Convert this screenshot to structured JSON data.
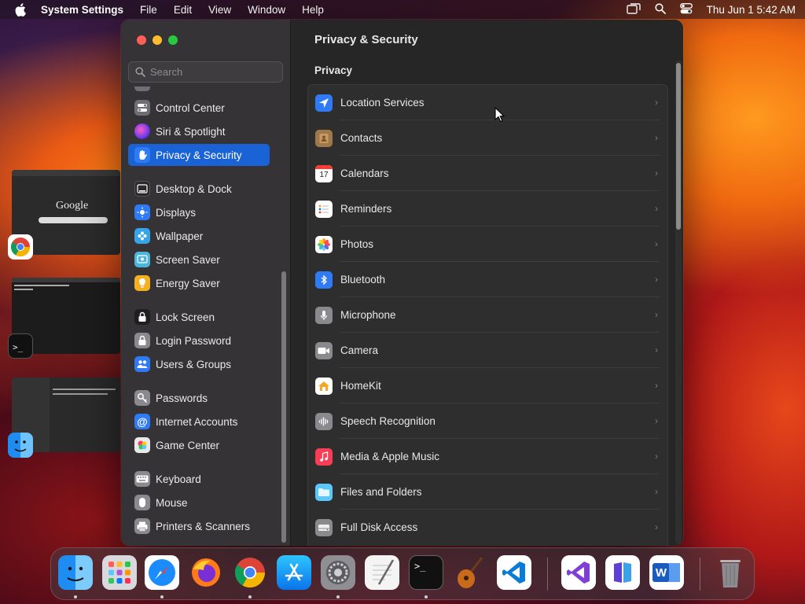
{
  "menubar": {
    "app_name": "System Settings",
    "menus": [
      "File",
      "Edit",
      "View",
      "Window",
      "Help"
    ],
    "clock": "Thu Jun 1  5:42 AM"
  },
  "window": {
    "search_placeholder": "Search",
    "sidebar": {
      "items": [
        {
          "label": "Control Center",
          "icon": "control-center-icon",
          "color": "#6e6e73"
        },
        {
          "label": "Siri & Spotlight",
          "icon": "siri-icon",
          "color": "#8f3ab8"
        },
        {
          "label": "Privacy & Security",
          "icon": "hand-icon",
          "color": "#2f7bf5",
          "selected": true
        },
        {
          "label": "Desktop & Dock",
          "icon": "dock-icon",
          "color": "#2a2a2a"
        },
        {
          "label": "Displays",
          "icon": "sun-icon",
          "color": "#2f7bf5"
        },
        {
          "label": "Wallpaper",
          "icon": "flower-icon",
          "color": "#35a5e8"
        },
        {
          "label": "Screen Saver",
          "icon": "screen-saver-icon",
          "color": "#4cb5d9"
        },
        {
          "label": "Energy Saver",
          "icon": "lightbulb-icon",
          "color": "#f5b021"
        },
        {
          "label": "Lock Screen",
          "icon": "lock-icon",
          "color": "#1f1f1f"
        },
        {
          "label": "Login Password",
          "icon": "lock-outline-icon",
          "color": "#8a8a8e"
        },
        {
          "label": "Users & Groups",
          "icon": "users-icon",
          "color": "#2f7bf5"
        },
        {
          "label": "Passwords",
          "icon": "key-icon",
          "color": "#8a8a8e"
        },
        {
          "label": "Internet Accounts",
          "icon": "at-icon",
          "color": "#2f7bf5"
        },
        {
          "label": "Game Center",
          "icon": "game-center-icon",
          "color": "#e9e9e9"
        },
        {
          "label": "Keyboard",
          "icon": "keyboard-icon",
          "color": "#8a8a8e"
        },
        {
          "label": "Mouse",
          "icon": "mouse-icon",
          "color": "#8a8a8e"
        },
        {
          "label": "Printers & Scanners",
          "icon": "printer-icon",
          "color": "#8a8a8e"
        }
      ]
    },
    "content": {
      "title": "Privacy & Security",
      "section": "Privacy",
      "rows": [
        {
          "label": "Location Services",
          "icon": "location-arrow-icon",
          "color": "#2f7bf5"
        },
        {
          "label": "Contacts",
          "icon": "contacts-icon",
          "color": "#a0784a"
        },
        {
          "label": "Calendars",
          "icon": "calendar-icon",
          "color": "#ffffff",
          "badge": "17"
        },
        {
          "label": "Reminders",
          "icon": "reminders-icon",
          "color": "#ffffff"
        },
        {
          "label": "Photos",
          "icon": "photos-icon",
          "color": "#ffffff"
        },
        {
          "label": "Bluetooth",
          "icon": "bluetooth-icon",
          "color": "#2f7bf5"
        },
        {
          "label": "Microphone",
          "icon": "microphone-icon",
          "color": "#8a8a8e"
        },
        {
          "label": "Camera",
          "icon": "camera-icon",
          "color": "#8a8a8e"
        },
        {
          "label": "HomeKit",
          "icon": "home-icon",
          "color": "#f5a623"
        },
        {
          "label": "Speech Recognition",
          "icon": "waveform-icon",
          "color": "#8a8a8e"
        },
        {
          "label": "Media & Apple Music",
          "icon": "music-note-icon",
          "color": "#fa3c55"
        },
        {
          "label": "Files and Folders",
          "icon": "folder-icon",
          "color": "#5ac8fa"
        },
        {
          "label": "Full Disk Access",
          "icon": "disk-icon",
          "color": "#8a8a8e"
        }
      ]
    }
  },
  "dock": {
    "apps": [
      {
        "name": "Finder",
        "icon": "finder-icon",
        "running": true
      },
      {
        "name": "Launchpad",
        "icon": "launchpad-icon",
        "running": false
      },
      {
        "name": "Safari",
        "icon": "safari-icon",
        "running": true
      },
      {
        "name": "Firefox",
        "icon": "firefox-icon",
        "running": false
      },
      {
        "name": "Google Chrome",
        "icon": "chrome-icon",
        "running": true
      },
      {
        "name": "App Store",
        "icon": "app-store-icon",
        "running": false
      },
      {
        "name": "System Settings",
        "icon": "settings-gear-icon",
        "running": true
      },
      {
        "name": "TextEdit",
        "icon": "textedit-icon",
        "running": false
      },
      {
        "name": "Terminal",
        "icon": "terminal-icon",
        "running": true
      },
      {
        "name": "GarageBand",
        "icon": "guitar-icon",
        "running": false
      },
      {
        "name": "Visual Studio Code",
        "icon": "vscode-icon",
        "running": false
      },
      {
        "name": "Visual Studio",
        "icon": "visual-studio-icon",
        "running": false
      },
      {
        "name": "Azure Data Studio",
        "icon": "data-studio-icon",
        "running": false
      },
      {
        "name": "Microsoft Word",
        "icon": "word-icon",
        "running": false
      },
      {
        "name": "Trash",
        "icon": "trash-icon",
        "running": false
      }
    ],
    "terminal_prompt": ">_",
    "word_letter": "W"
  }
}
